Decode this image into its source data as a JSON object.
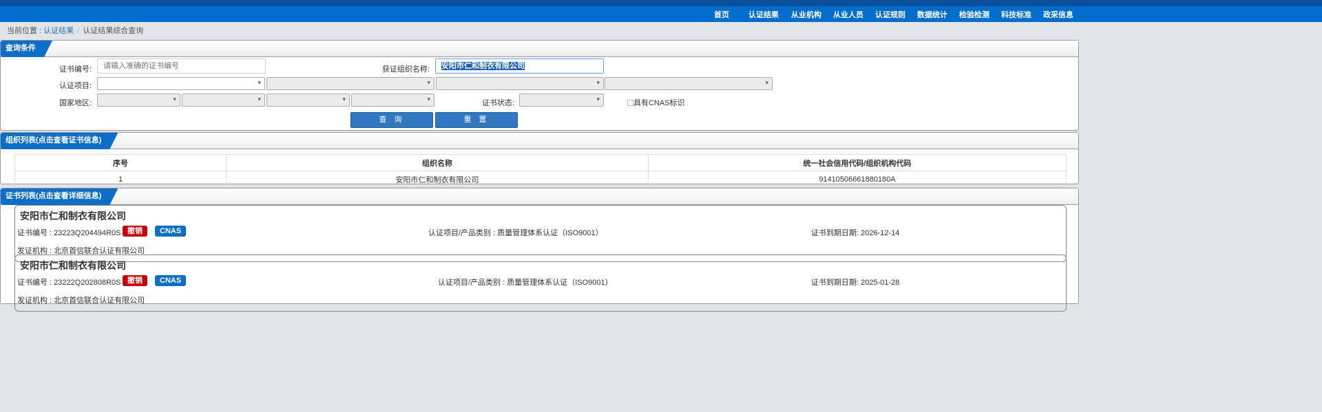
{
  "nav": [
    "首页",
    "认证结果",
    "从业机构",
    "从业人员",
    "认证规则",
    "数据统计",
    "检验检测",
    "科技标准",
    "政采信息"
  ],
  "breadcrumb": {
    "prefix": "当前位置 : ",
    "link": "认证结果",
    "sep": "/",
    "current": "认证结果综合查询"
  },
  "query": {
    "title": "查询条件",
    "cert_no_label": "证书编号:",
    "cert_no_placeholder": "请输入准确的证书编号",
    "org_label": "获证组织名称:",
    "org_value": "安阳市仁和制衣有限公司",
    "project_label": "认证项目:",
    "region_label": "国家地区:",
    "status_label": "证书状态:",
    "cnas_label": "具有CNAS标识",
    "search": "查 询",
    "reset": "重 置"
  },
  "orgs": {
    "title": "组织列表(点击查看证书信息)",
    "headers": [
      "序号",
      "组织名称",
      "统一社会信用代码/组织机构代码"
    ],
    "rows": [
      [
        "1",
        "安阳市仁和制衣有限公司",
        "91410506661880180A"
      ]
    ]
  },
  "certs": {
    "title": "证书列表(点击查看详细信息)",
    "items": [
      {
        "name": "安阳市仁和制衣有限公司",
        "no": "证书编号 : 23223Q204494R0S",
        "status": "撤销",
        "cnas": "CNAS",
        "project": "认证项目/产品类别 : 质量管理体系认证（ISO9001）",
        "expiry": "证书到期日期: 2026-12-14",
        "issuer": "发证机构 : 北京首信联合认证有限公司"
      },
      {
        "name": "安阳市仁和制衣有限公司",
        "no": "证书编号 : 23222Q202808R0S",
        "status": "撤销",
        "cnas": "CNAS",
        "project": "认证项目/产品类别 : 质量管理体系认证（ISO9001）",
        "expiry": "证书到期日期: 2025-01-28",
        "issuer": "发证机构 : 北京首信联合认证有限公司"
      }
    ]
  }
}
